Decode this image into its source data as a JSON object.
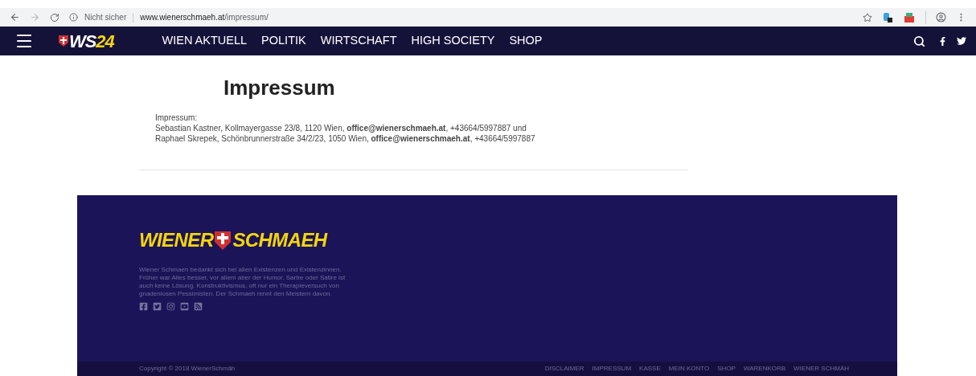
{
  "browser": {
    "security": "Nicht sicher",
    "url_host": "www.wienerschmaeh.at",
    "url_path": "/impressum/"
  },
  "nav": {
    "logo_a": "WS",
    "logo_b": "24",
    "items": [
      {
        "label": "WIEN AKTUELL"
      },
      {
        "label": "POLITIK"
      },
      {
        "label": "WIRTSCHAFT"
      },
      {
        "label": "HIGH SOCIETY"
      },
      {
        "label": "SHOP"
      }
    ]
  },
  "page": {
    "title": "Impressum",
    "lines": [
      "Impressum:",
      "Sebastian Kastner, Kollmayergasse 23/8, 1120 Wien, **office@wienerschmaeh.at**, +43664/5997887 und",
      "Raphael Skrepek, Schönbrunnerstraße 34/2/23, 1050 Wien, **office@wienerschmaeh.at**, +43664/5997887"
    ]
  },
  "footer": {
    "logo_a": "WIENER",
    "logo_b": "SCHMAEH",
    "about": "Wiener Schmaeh bedankt sich bei allen Existenzen und Existenzinnen. Früher war Alles besser, vor allem aber der Humor. Sartre oder Satire ist auch keine Lösung. Konstruktivismus, oft nur ein Therapieversuch von gnadenlosen Pessimisten. Der Schmaeh rennt den Meistern davon.",
    "copyright": "Copyright © 2018 WienerSchmäh",
    "links": [
      "DISCLAIMER",
      "IMPRESSUM",
      "KASSE",
      "MEIN KONTO",
      "SHOP",
      "WARENKORB",
      "WIENER SCHMÄH"
    ]
  }
}
